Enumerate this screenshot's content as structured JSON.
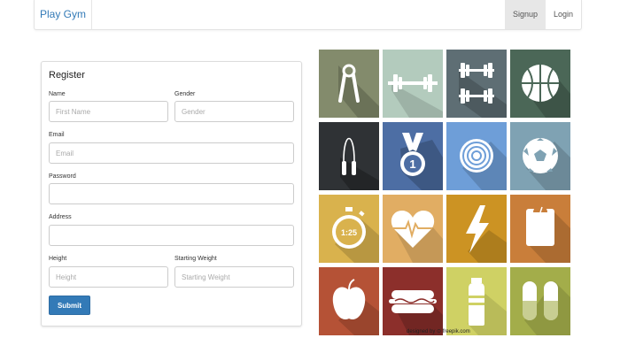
{
  "nav": {
    "brand": "Play Gym",
    "signup": "Signup",
    "login": "Login"
  },
  "form": {
    "title": "Register",
    "name_label": "Name",
    "name_placeholder": "First Name",
    "gender_label": "Gender",
    "gender_placeholder": "Gender",
    "email_label": "Email",
    "email_placeholder": "Email",
    "password_label": "Password",
    "password_placeholder": "",
    "address_label": "Address",
    "address_placeholder": "",
    "height_label": "Height",
    "height_placeholder": "Height",
    "weight_label": "Starting Weight",
    "weight_placeholder": "Starting Weight",
    "submit_label": "Submit"
  },
  "tiles": [
    {
      "icon": "hand-grip-icon",
      "color": "#838b6c"
    },
    {
      "icon": "barbell-icon",
      "color": "#b3cbbd"
    },
    {
      "icon": "dumbbells-icon",
      "color": "#5e6e74"
    },
    {
      "icon": "basketball-icon",
      "color": "#4b6757"
    },
    {
      "icon": "jump-rope-icon",
      "color": "#2f3235"
    },
    {
      "icon": "medal-icon",
      "color": "#4d6ea4"
    },
    {
      "icon": "target-icon",
      "color": "#6e9ed8"
    },
    {
      "icon": "soccer-ball-icon",
      "color": "#7fa2b3"
    },
    {
      "icon": "stopwatch-icon",
      "color": "#d9b24d"
    },
    {
      "icon": "heartbeat-icon",
      "color": "#e1ad63"
    },
    {
      "icon": "lightning-icon",
      "color": "#cc9323"
    },
    {
      "icon": "scale-icon",
      "color": "#c97e3a"
    },
    {
      "icon": "apple-icon",
      "color": "#b55236"
    },
    {
      "icon": "hotdog-icon",
      "color": "#8c2f2b"
    },
    {
      "icon": "bottle-icon",
      "color": "#cfd164"
    },
    {
      "icon": "pills-icon",
      "color": "#a3ad4a"
    }
  ],
  "stopwatch_text": "1:25",
  "medal_text": "1",
  "credit": "designed by ⊙ freepik.com"
}
